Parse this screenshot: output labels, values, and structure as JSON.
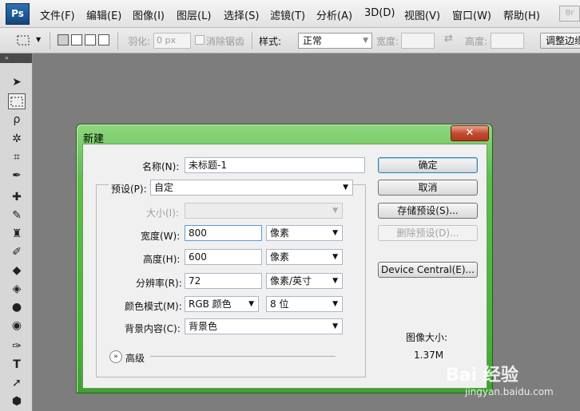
{
  "app": {
    "logo": "Ps",
    "bridge_logo": "Br"
  },
  "menu": [
    "文件(F)",
    "编辑(E)",
    "图像(I)",
    "图层(L)",
    "选择(S)",
    "滤镜(T)",
    "分析(A)",
    "3D(D)",
    "视图(V)",
    "窗口(W)",
    "帮助(H)"
  ],
  "options": {
    "feather_label": "羽化:",
    "feather_value": "0 px",
    "antialias_label": "消除锯齿",
    "style_label": "样式:",
    "style_value": "正常",
    "width_label": "宽度:",
    "height_label": "高度:",
    "refine_label": "调整边缘"
  },
  "dialog": {
    "title": "新建",
    "close_symbol": "✕",
    "name_label": "名称(N):",
    "name_value": "未标题-1",
    "preset_label": "预设(P):",
    "preset_value": "自定",
    "size_label": "大小(I):",
    "width_label": "宽度(W):",
    "width_value": "800",
    "width_unit": "像素",
    "height_label": "高度(H):",
    "height_value": "600",
    "height_unit": "像素",
    "resolution_label": "分辨率(R):",
    "resolution_value": "72",
    "resolution_unit": "像素/英寸",
    "color_mode_label": "颜色模式(M):",
    "color_mode_value": "RGB 颜色",
    "bit_depth_value": "8 位",
    "background_label": "背景内容(C):",
    "background_value": "背景色",
    "advanced_label": "高级",
    "buttons": {
      "ok": "确定",
      "cancel": "取消",
      "save_preset": "存储预设(S)...",
      "delete_preset": "删除预设(D)...",
      "device_central": "Device Central(E)..."
    },
    "image_size_label": "图像大小:",
    "image_size_value": "1.37M"
  },
  "watermark": {
    "logo": "Bai  经验",
    "url": "jingyan.baidu.com"
  },
  "colors": {
    "accent_green": "#49b13a",
    "close_red": "#c44a2f",
    "workspace": "#7d7d7d"
  }
}
